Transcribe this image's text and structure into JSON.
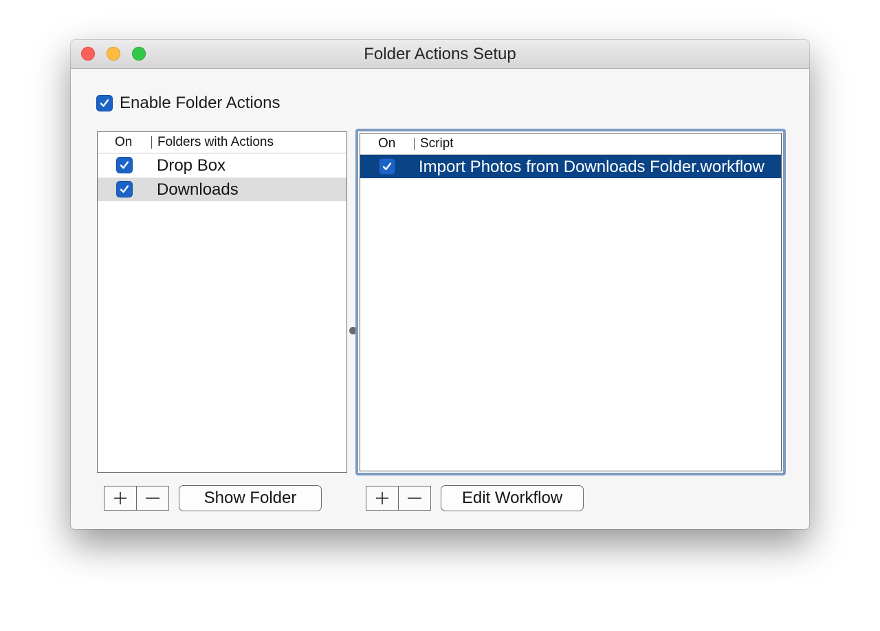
{
  "window": {
    "title": "Folder Actions Setup"
  },
  "enable": {
    "label": "Enable Folder Actions",
    "checked": true
  },
  "folders_table": {
    "columns": [
      "On",
      "Folders with Actions"
    ],
    "rows": [
      {
        "on": true,
        "name": "Drop Box"
      },
      {
        "on": true,
        "name": "Downloads"
      }
    ],
    "selected_row": "Downloads"
  },
  "scripts_table": {
    "columns": [
      "On",
      "Script"
    ],
    "rows": [
      {
        "on": true,
        "name": "Import Photos from Downloads Folder.workflow"
      }
    ],
    "selected_row": "Import Photos from Downloads Folder.workflow"
  },
  "buttons": {
    "add_folder": "+",
    "remove_folder": "−",
    "show_folder": "Show Folder",
    "add_script": "+",
    "remove_script": "−",
    "edit_workflow": "Edit Workflow"
  },
  "icons": {
    "checkmark": "checkmark-icon",
    "plus": "plus-icon",
    "minus": "minus-icon"
  },
  "colors": {
    "checkbox": "#1b63c6",
    "selection_blue": "#0b4486",
    "selection_gray": "#dcdcdc",
    "focus_ring": "#7d9bc2"
  }
}
